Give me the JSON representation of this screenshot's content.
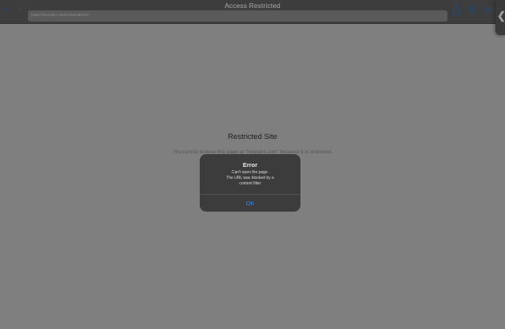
{
  "navbar": {
    "title": "Access Restricted",
    "back_label": "<",
    "forward_label": ">",
    "url": "https://livepaint.com/art/3401882417",
    "done_label": "Done"
  },
  "side_handle": {
    "chevron": "❮"
  },
  "page": {
    "heading": "Restricted Site",
    "message": "You cannot browse this page at \"livepaint.com\" because it is restricted."
  },
  "alert": {
    "title": "Error",
    "message_lines": [
      "Can't open the page.",
      "The URL was blocked by a",
      "content filter"
    ],
    "ok_label": "OK"
  },
  "icons": {
    "share": "share-icon",
    "compass": "compass-icon"
  },
  "colors": {
    "accent": "#3d82d4",
    "dim_overlay": "#7f7f7f",
    "alert_bg": "#3a3a3a"
  }
}
